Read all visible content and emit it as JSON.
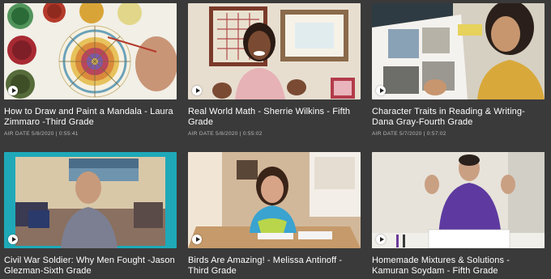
{
  "videos": [
    {
      "title": "How to Draw and Paint a Mandala - Laura Zimmaro -Third Grade",
      "meta": "AIR DATE 5/8/2020 | 0:55:41",
      "thumb": "mandala-painting",
      "play_icon": "play-icon"
    },
    {
      "title": "Real World Math - Sherrie Wilkins - Fifth Grade",
      "meta": "AIR DATE 5/8/2020 | 0:55:02",
      "thumb": "teacher-smiling",
      "play_icon": "play-icon"
    },
    {
      "title": "Character Traits in Reading & Writing- Dana Gray-Fourth Grade",
      "meta": "AIR DATE 5/7/2020 | 0:57:02",
      "thumb": "teacher-with-book",
      "play_icon": "play-icon"
    },
    {
      "title": "Civil War Soldier: Why Men Fought -Jason Glezman-Sixth Grade",
      "meta": "",
      "thumb": "teacher-on-couch",
      "play_icon": "play-icon"
    },
    {
      "title": "Birds Are Amazing! - Melissa Antinoff - Third Grade",
      "meta": "",
      "thumb": "teacher-at-table",
      "play_icon": "play-icon"
    },
    {
      "title": "Homemade Mixtures & Solutions - Kamuran Soydam - Fifth Grade",
      "meta": "",
      "thumb": "teacher-thumbs-up",
      "play_icon": "play-icon"
    }
  ],
  "colors": {
    "page_bg": "#3a3a3a",
    "title": "#ffffff",
    "meta": "#b9b9b9",
    "accent_teal": "#1fa9b8"
  }
}
